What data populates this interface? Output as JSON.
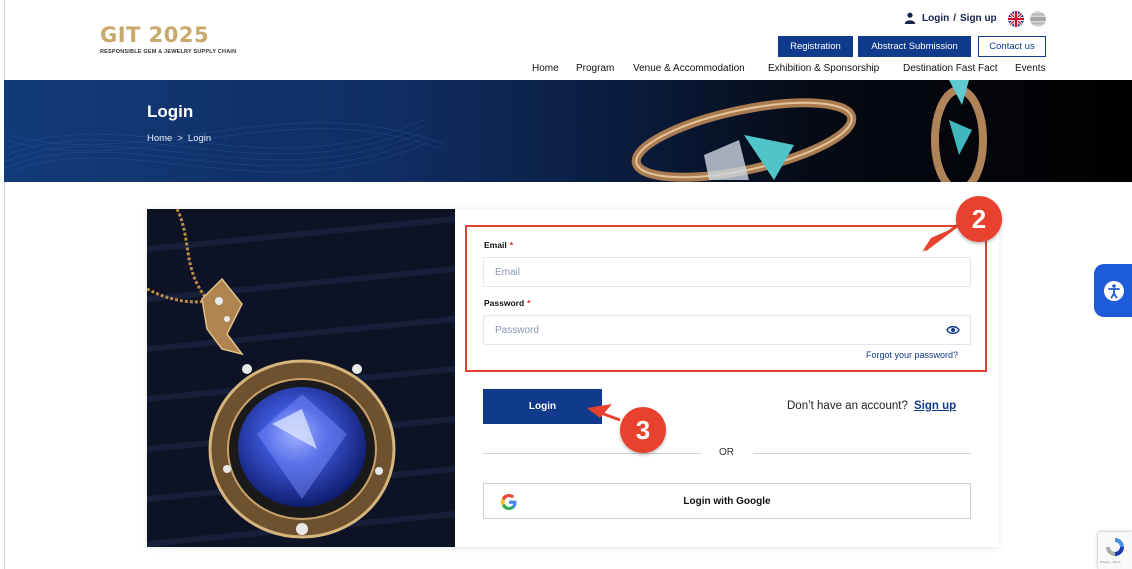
{
  "header": {
    "logo_title": "GIT 2025",
    "logo_subtitle": "RESPONSIBLE GEM & JEWELRY SUPPLY CHAIN",
    "auth_login": "Login",
    "auth_separator": "/",
    "auth_signup": "Sign up",
    "buttons": {
      "registration": "Registration",
      "abstract": "Abstract Submission",
      "contact": "Contact us"
    },
    "nav": [
      "Home",
      "Program",
      "Venue & Accommodation",
      "Exhibition & Sponsorship",
      "Destination Fast Fact",
      "Events"
    ]
  },
  "banner": {
    "title": "Login",
    "breadcrumb": [
      "Home",
      ">",
      "Login"
    ]
  },
  "form": {
    "email_label": "Email",
    "email_placeholder": "Email",
    "password_label": "Password",
    "password_placeholder": "Password",
    "required_mark": "*",
    "forgot": "Forgot your password?",
    "login_button": "Login",
    "no_account": "Don’t have an account?",
    "signup_link": "Sign up",
    "or": "OR",
    "google_button": "Login with Google"
  },
  "annotations": {
    "step_2": "2",
    "step_3": "3",
    "color": "#e8412d"
  },
  "recaptcha": {
    "footer": "Privacy - Terms"
  },
  "colors": {
    "primary": "#103a8c",
    "gold": "#c8a86b",
    "accessibility": "#1e5bd8"
  },
  "icons": [
    "user-icon",
    "uk-flag-icon",
    "thai-flag-icon",
    "eye-icon",
    "google-icon",
    "accessibility-icon",
    "recaptcha-icon"
  ]
}
